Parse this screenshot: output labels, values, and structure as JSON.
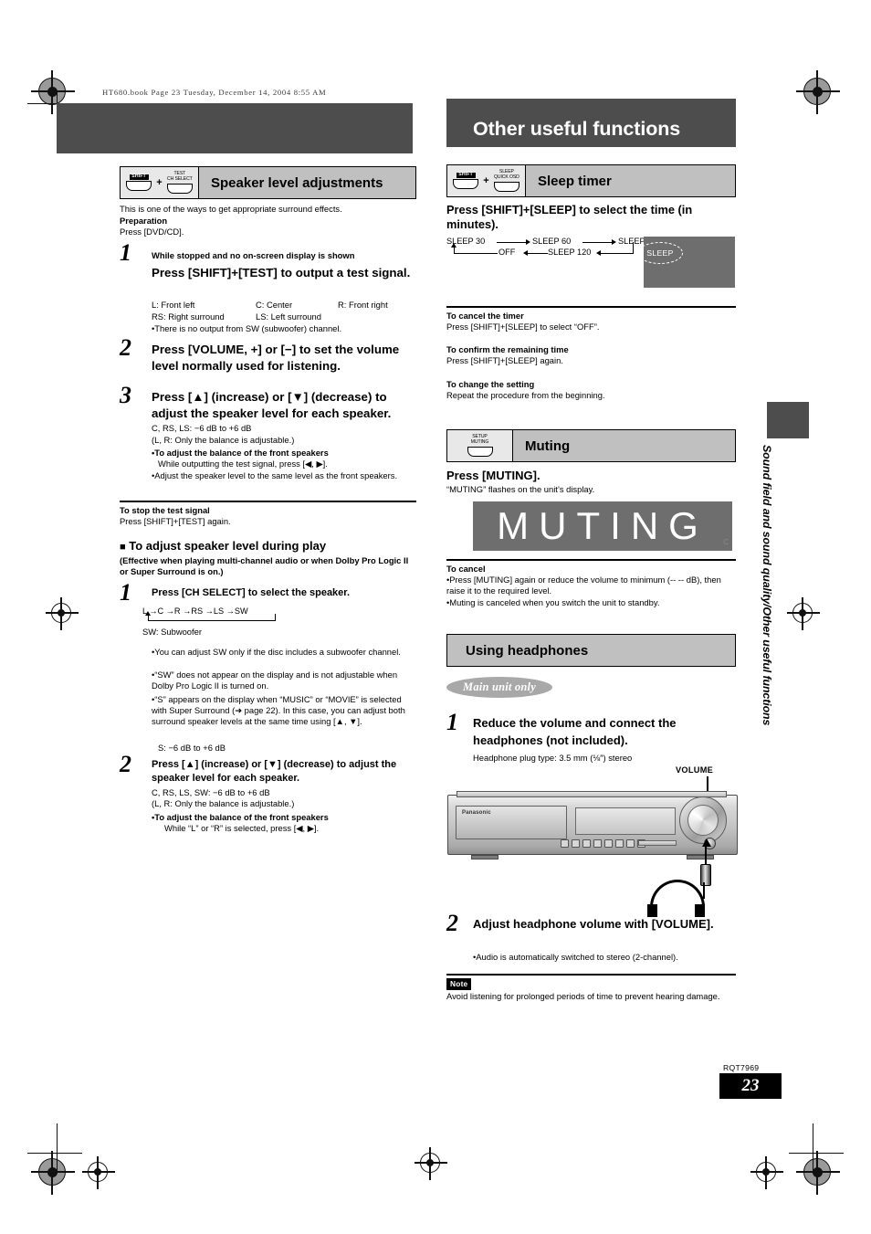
{
  "file_header": "HT680.book  Page 23  Tuesday, December 14, 2004  8:55 AM",
  "chapter_title": "Other useful functions",
  "side_tab_text": "Sound field and sound quality/Other useful functions",
  "footer": {
    "code": "RQT7969",
    "page": "23"
  },
  "left_column": {
    "section": {
      "title": "Speaker level adjustments",
      "button_1": {
        "label": "SHIFT",
        "inverted": true
      },
      "button_2": {
        "line1": "TEST",
        "line2": "CH SELECT",
        "inverted": false
      },
      "plus": "+"
    },
    "intro": "This is one of the ways to get appropriate surround effects.",
    "preparation_label": "Preparation",
    "preparation_text": "Press [DVD/CD].",
    "step1": {
      "number": "1",
      "condition": "While stopped and no on-screen display is shown",
      "heading": "Press [SHIFT]+[TEST] to output a test signal.",
      "legend": [
        [
          "L:  Front left",
          "C:  Center",
          "R:  Front right"
        ],
        [
          "RS:  Right surround",
          "LS:  Left surround",
          ""
        ]
      ],
      "bullet": "There is no output from SW (subwoofer) channel."
    },
    "step2": {
      "number": "2",
      "heading": "Press [VOLUME, +] or [−] to set the volume level normally used for listening."
    },
    "step3": {
      "number": "3",
      "heading": "Press [▲] (increase) or [▼] (decrease) to adjust the speaker level for each speaker.",
      "range": "C, RS, LS: −6 dB to +6 dB",
      "note": "(L, R: Only the balance is adjustable.)",
      "bullet1_bold": "To adjust the balance of the front speakers",
      "bullet1_text": "While outputting the test signal, press [◀, ▶].",
      "bullet2": "Adjust the speaker level to the same level as the front speakers."
    },
    "stop_test": {
      "heading": "To stop the test signal",
      "text": "Press [SHIFT]+[TEST] again."
    },
    "during_play": {
      "heading": "To adjust speaker level during play",
      "subtext": "(Effective when playing multi-channel audio or when Dolby Pro Logic II or Super Surround is on.)",
      "step1": {
        "number": "1",
        "heading": "Press [CH SELECT] to select the speaker.",
        "cycle": [
          "L",
          "C",
          "R",
          "RS",
          "LS",
          "SW"
        ],
        "sw_note": "SW: Subwoofer",
        "bullets": [
          "You can adjust SW only if the disc includes a subwoofer channel.",
          "“SW” does not appear on the display and is not adjustable when Dolby Pro Logic II is turned on.",
          "“S” appears on the display when “MUSIC” or “MOVIE” is selected with Super Surround (➜ page 22). In this case, you can adjust both surround speaker levels at the same time using [▲, ▼].",
          "S: −6 dB to +6 dB"
        ]
      },
      "step2": {
        "number": "2",
        "heading": "Press [▲] (increase) or [▼] (decrease) to adjust the speaker level for each speaker.",
        "range": "C, RS, LS, SW: −6 dB to +6 dB",
        "note": "(L, R: Only the balance is adjustable.)",
        "bullet_bold": "To adjust the balance of the front speakers",
        "bullet_text": "While “L” or “R” is selected, press [◀, ▶]."
      }
    }
  },
  "right_column": {
    "sleep_section": {
      "title": "Sleep timer",
      "button_1": {
        "label": "SHIFT",
        "inverted": true
      },
      "button_2": {
        "line1": "SLEEP",
        "line2": "QUICK OSD",
        "inverted": false
      },
      "plus": "+",
      "heading": "Press [SHIFT]+[SLEEP] to select the time (in minutes).",
      "cycle_top": [
        "SLEEP 30",
        "SLEEP 60",
        "SLEEP 90"
      ],
      "cycle_bottom": [
        "OFF",
        "SLEEP 120"
      ],
      "display_label": "SLEEP",
      "cancel": {
        "heading": "To cancel the timer",
        "text": "Press [SHIFT]+[SLEEP] to select “OFF”."
      },
      "confirm": {
        "heading": "To confirm the remaining time",
        "text": "Press [SHIFT]+[SLEEP] again."
      },
      "change": {
        "heading": "To change the setting",
        "text": "Repeat the procedure from the beginning."
      }
    },
    "muting_section": {
      "title": "Muting",
      "button": {
        "line1": "SETUP",
        "line2": "MUTING",
        "inverted": false
      },
      "heading": "Press [MUTING].",
      "subtext": "“MUTING” flashes on the unit’s display.",
      "display_text": "MUTING",
      "display_corner": "C",
      "cancel_heading": "To cancel",
      "cancel_bullets": [
        "Press [MUTING] again or reduce the volume to minimum (-- -- dB), then raise it to the required level.",
        "Muting is canceled when you switch the unit to standby."
      ]
    },
    "headphones_section": {
      "title": "Using headphones",
      "badge": "Main unit only",
      "step1": {
        "number": "1",
        "heading": "Reduce the volume and connect the headphones (not included).",
        "detail": "Headphone plug type:  3.5 mm (⅛″) stereo"
      },
      "volume_label": "VOLUME",
      "unit_brand": "Panasonic",
      "step2": {
        "number": "2",
        "heading": "Adjust headphone volume with [VOLUME].",
        "bullet": "Audio is automatically switched to stereo (2-channel)."
      },
      "note_tag": "Note",
      "note_text": "Avoid listening for prolonged periods of time to prevent hearing damage."
    }
  }
}
